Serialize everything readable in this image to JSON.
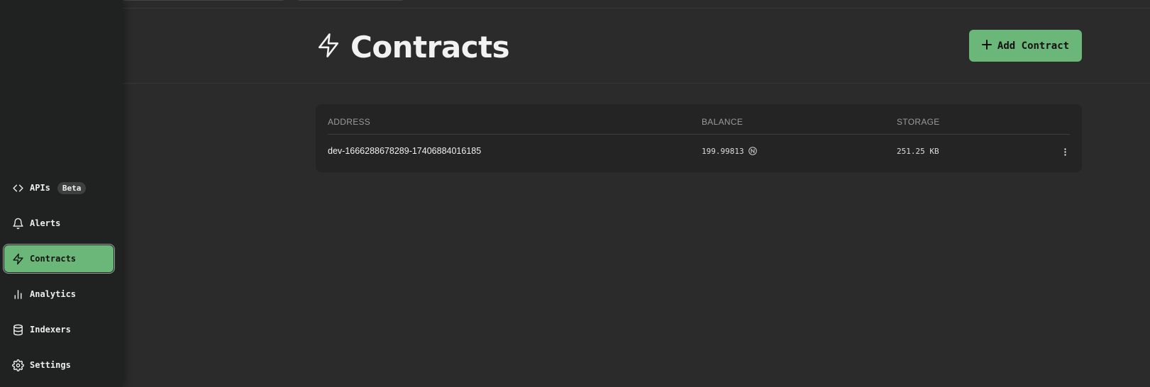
{
  "sidebar": {
    "items": [
      {
        "label": "APIs",
        "icon": "code-icon",
        "badge": "Beta",
        "active": false
      },
      {
        "label": "Alerts",
        "icon": "bell-icon",
        "active": false
      },
      {
        "label": "Contracts",
        "icon": "lightning-icon",
        "active": true
      },
      {
        "label": "Analytics",
        "icon": "bar-chart-icon",
        "active": false
      },
      {
        "label": "Indexers",
        "icon": "database-icon",
        "active": false
      },
      {
        "label": "Settings",
        "icon": "gear-icon",
        "active": false
      }
    ]
  },
  "header": {
    "title": "Contracts",
    "title_icon": "lightning-icon",
    "add_button_label": "Add Contract",
    "add_button_icon": "plus-icon"
  },
  "table": {
    "columns": [
      "ADDRESS",
      "BALANCE",
      "STORAGE"
    ],
    "rows": [
      {
        "address": "dev-1666288678289-17406884016185",
        "balance": "199.99813",
        "balance_icon": "near-token-icon",
        "storage": "251.25 KB",
        "menu_icon": "kebab-menu-icon"
      }
    ]
  },
  "colors": {
    "accent": "#6bb679",
    "background": "#2b2b2b",
    "sidebar": "#202221",
    "card": "#242424"
  }
}
